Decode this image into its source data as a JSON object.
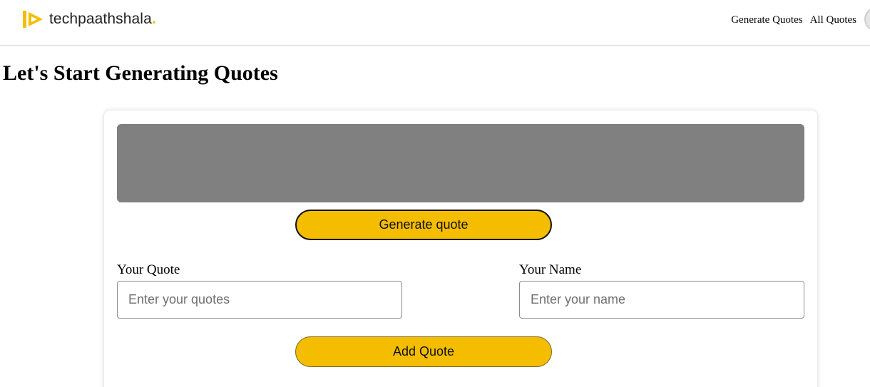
{
  "header": {
    "brand_name": "techpaathshala",
    "brand_dot": ".",
    "nav_links": [
      "Generate Quotes",
      "All Quotes"
    ]
  },
  "page": {
    "title": "Let's Start Generating Quotes"
  },
  "generator": {
    "quote_text": "",
    "generate_button": "Generate quote"
  },
  "form": {
    "quote_label": "Your Quote",
    "quote_placeholder": "Enter your quotes",
    "name_label": "Your Name",
    "name_placeholder": "Enter your name",
    "add_button": "Add Quote"
  },
  "colors": {
    "accent": "#f4bd00",
    "quote_box": "#808080"
  }
}
